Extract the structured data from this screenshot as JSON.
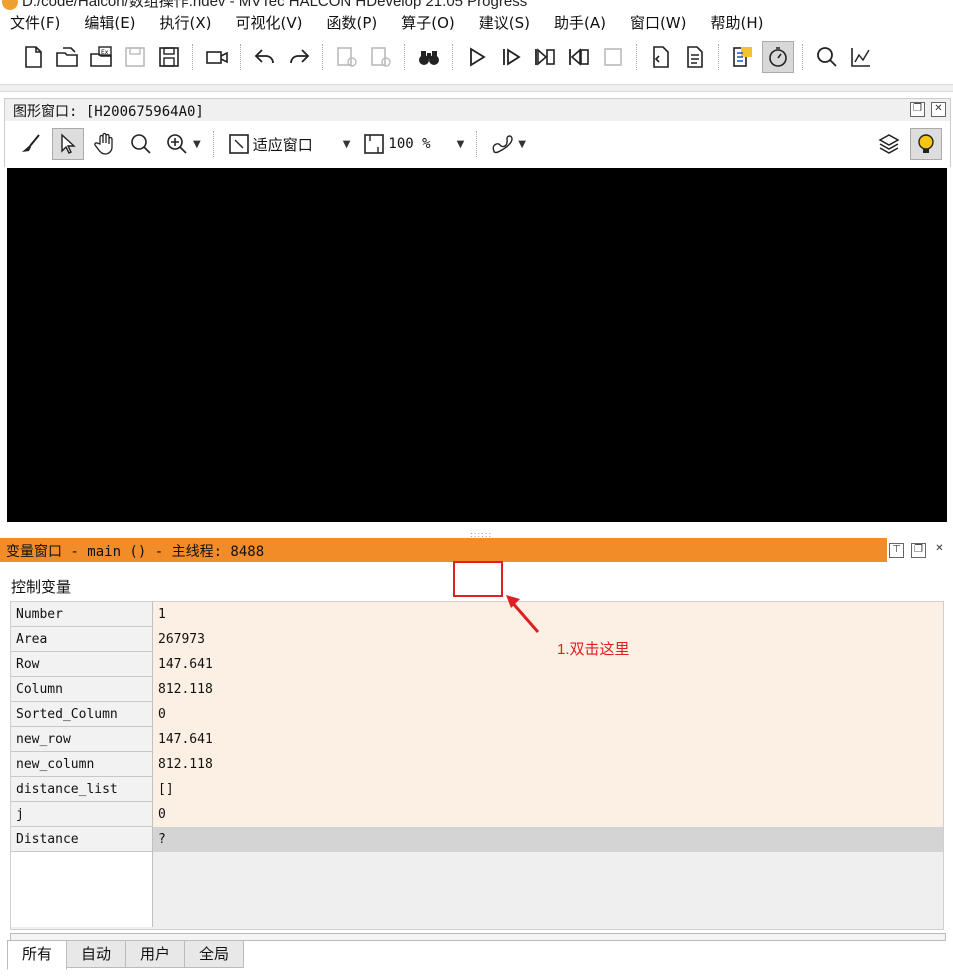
{
  "window": {
    "title": "D:/code/Halcon/数组操作.hdev - MVTec HALCON HDevelop 21.05 Progress"
  },
  "menu": [
    "文件(F)",
    "编辑(E)",
    "执行(X)",
    "可视化(V)",
    "函数(P)",
    "算子(O)",
    "建议(S)",
    "助手(A)",
    "窗口(W)",
    "帮助(H)"
  ],
  "graphics_window": {
    "title": "图形窗口: [H200675964A0]",
    "fit_label": "适应窗口",
    "zoom_label": "100 %"
  },
  "variable_window": {
    "title": "变量窗口 - main () - 主线程: 8488",
    "section_label": "控制变量",
    "variables": [
      {
        "name": "Number",
        "value": "1"
      },
      {
        "name": "Area",
        "value": "267973"
      },
      {
        "name": "Row",
        "value": "147.641"
      },
      {
        "name": "Column",
        "value": "812.118"
      },
      {
        "name": "Sorted_Column",
        "value": "0"
      },
      {
        "name": "new_row",
        "value": "147.641"
      },
      {
        "name": "new_column",
        "value": "812.118"
      },
      {
        "name": "distance_list",
        "value": "[]"
      },
      {
        "name": "j",
        "value": "0"
      },
      {
        "name": "Distance",
        "value": "?"
      }
    ],
    "tabs": [
      "所有",
      "自动",
      "用户",
      "全局"
    ]
  },
  "annotation": {
    "text": "1.双击这里",
    "color": "#e02020"
  },
  "colors": {
    "accent": "#f28c28",
    "row_bg": "#fcf0e4"
  }
}
